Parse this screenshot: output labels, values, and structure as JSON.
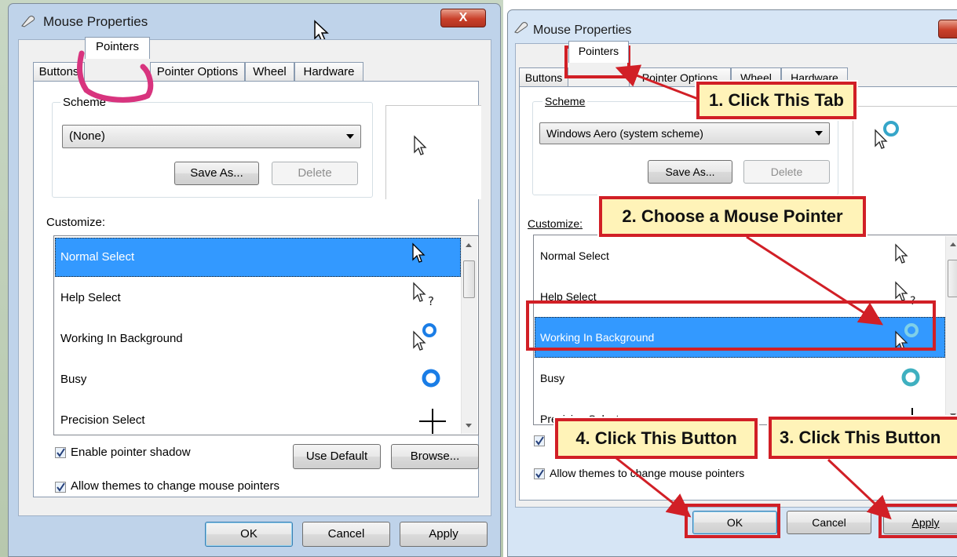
{
  "left": {
    "title": "Mouse Properties",
    "close_label": "X",
    "tabs": [
      "Buttons",
      "Pointers",
      "Pointer Options",
      "Wheel",
      "Hardware"
    ],
    "scheme_label": "Scheme",
    "scheme_value": "(None)",
    "save_as_label": "Save As...",
    "delete_label": "Delete",
    "customize_label": "Customize:",
    "list_items": [
      "Normal Select",
      "Help Select",
      "Working In Background",
      "Busy",
      "Precision Select"
    ],
    "enable_shadow_label": "Enable pointer shadow",
    "use_default_label": "Use Default",
    "browse_label": "Browse...",
    "allow_themes_label": "Allow themes to change mouse pointers",
    "ok_label": "OK",
    "cancel_label": "Cancel",
    "apply_label": "Apply"
  },
  "right": {
    "title": "Mouse Properties",
    "tabs": [
      "Buttons",
      "Pointers",
      "Pointer Options",
      "Wheel",
      "Hardware"
    ],
    "scheme_label": "Scheme",
    "scheme_value": "Windows Aero (system scheme)",
    "save_as_label": "Save As...",
    "delete_label": "Delete",
    "customize_label": "Customize:",
    "list_items": [
      "Normal Select",
      "Help Select",
      "Working In Background",
      "Busy",
      "Precision Select"
    ],
    "allow_themes_label": "Allow themes to change mouse pointers",
    "ok_label": "OK",
    "cancel_label": "Cancel",
    "apply_label": "Apply",
    "callouts": {
      "step1": "1. Click This Tab",
      "step2": "2. Choose a Mouse Pointer",
      "step3": "3. Click This Button",
      "step4": "4. Click This Button"
    }
  },
  "colors": {
    "selection": "#3399ff",
    "callout_border": "#d11f26",
    "callout_fill": "#fff3b8",
    "marker": "#d8347e"
  }
}
